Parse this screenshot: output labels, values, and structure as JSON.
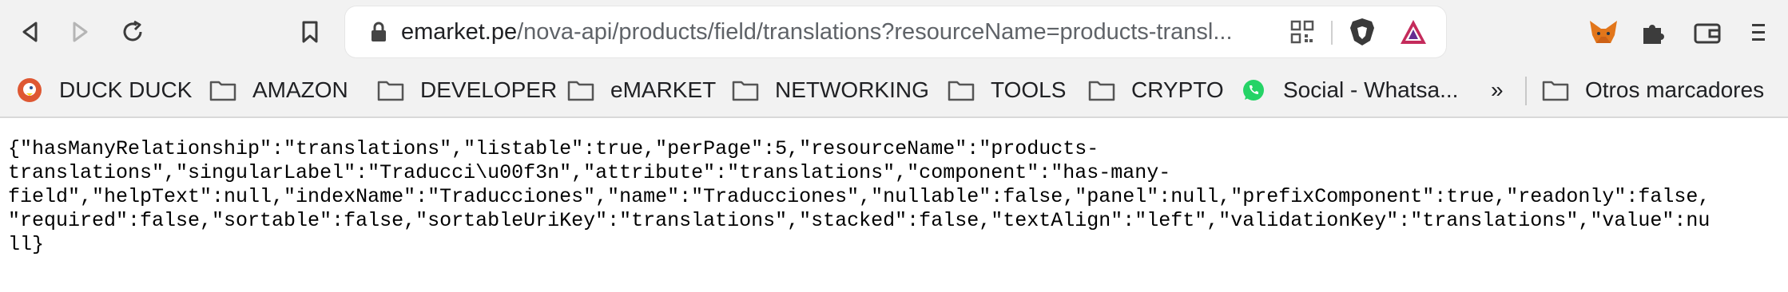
{
  "toolbar": {
    "back_icon": "back-arrow-icon",
    "forward_icon": "forward-arrow-icon",
    "reload_icon": "reload-icon",
    "bookmark_icon": "bookmark-icon"
  },
  "address_bar": {
    "host": "emarket.pe",
    "path": "/nova-api/products/field/translations?resourceName=products-transl...",
    "lock_icon": "lock-icon",
    "qr_icon": "qr-code-icon",
    "brave_icon": "brave-shield-icon",
    "rewards_icon": "brave-rewards-icon"
  },
  "extensions": {
    "metamask_icon": "metamask-fox-icon",
    "puzzle_icon": "extensions-puzzle-icon",
    "wallet_icon": "wallet-icon",
    "menu_icon": "menu-icon"
  },
  "bookmarks": {
    "items": [
      {
        "label": "DUCK DUCK",
        "icon": "duckduckgo-icon"
      },
      {
        "label": "AMAZON",
        "icon": "folder-icon"
      },
      {
        "label": "DEVELOPER",
        "icon": "folder-icon"
      },
      {
        "label": "eMARKET",
        "icon": "folder-icon"
      },
      {
        "label": "NETWORKING",
        "icon": "folder-icon"
      },
      {
        "label": "TOOLS",
        "icon": "folder-icon"
      },
      {
        "label": "CRYPTO",
        "icon": "folder-icon"
      },
      {
        "label": "Social - Whatsa...",
        "icon": "whatsapp-icon"
      }
    ],
    "overflow_label": "»",
    "other_label": "Otros marcadores"
  },
  "content": {
    "lines": [
      "{\"hasManyRelationship\":\"translations\",\"listable\":true,\"perPage\":5,\"resourceName\":\"products-",
      "translations\",\"singularLabel\":\"Traducci\\u00f3n\",\"attribute\":\"translations\",\"component\":\"has-many-",
      "field\",\"helpText\":null,\"indexName\":\"Traducciones\",\"name\":\"Traducciones\",\"nullable\":false,\"panel\":null,\"prefixComponent\":true,\"readonly\":false,",
      "\"required\":false,\"sortable\":false,\"sortableUriKey\":\"translations\",\"stacked\":false,\"textAlign\":\"left\",\"validationKey\":\"translations\",\"value\":nu",
      "ll}"
    ]
  }
}
